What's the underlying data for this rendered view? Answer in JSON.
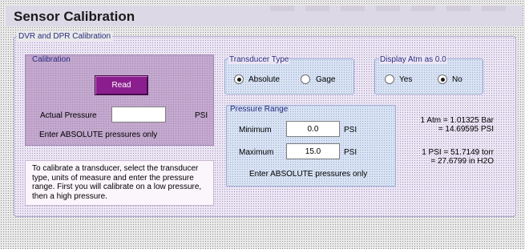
{
  "header": {
    "title": "Sensor Calibration"
  },
  "dvr_dpr": {
    "legend": "DVR and DPR Calibration"
  },
  "calibration": {
    "legend": "Calibration",
    "read_button": "Read",
    "actual_pressure_label": "Actual Pressure",
    "actual_pressure_value": "",
    "actual_pressure_unit": "PSI",
    "absolute_note": "Enter ABSOLUTE pressures only"
  },
  "instructions": [
    "To calibrate a transducer, select the transducer",
    "type, units of measure and enter the  pressure",
    "range.  First you will calibrate on a low pressure,",
    "then a high pressure."
  ],
  "transducer_type": {
    "legend": "Transducer Type",
    "options": [
      {
        "label": "Absolute",
        "selected": true
      },
      {
        "label": "Gage",
        "selected": false
      }
    ]
  },
  "display_atm": {
    "legend": "Display Atm as 0.0",
    "options": [
      {
        "label": "Yes",
        "selected": false
      },
      {
        "label": "No",
        "selected": true
      }
    ]
  },
  "pressure_range": {
    "legend": "Pressure Range",
    "minimum_label": "Minimum",
    "minimum_value": "0.0",
    "minimum_unit": "PSI",
    "maximum_label": "Maximum",
    "maximum_value": "15.0",
    "maximum_unit": "PSI",
    "absolute_note": "Enter ABSOLUTE pressures only"
  },
  "conversions": {
    "atm_line1": "1 Atm = 1.01325 Bar",
    "atm_line2": "= 14.69595 PSI",
    "psi_line1": "1 PSI = 51.7149 torr",
    "psi_line2": "= 27.6799  in H2O"
  },
  "colors": {
    "read_button": "#8b1e8e",
    "calibration_panel": "#c4a9cf",
    "group_box": "#d9e3f3",
    "legend_text": "#2a2a80"
  }
}
